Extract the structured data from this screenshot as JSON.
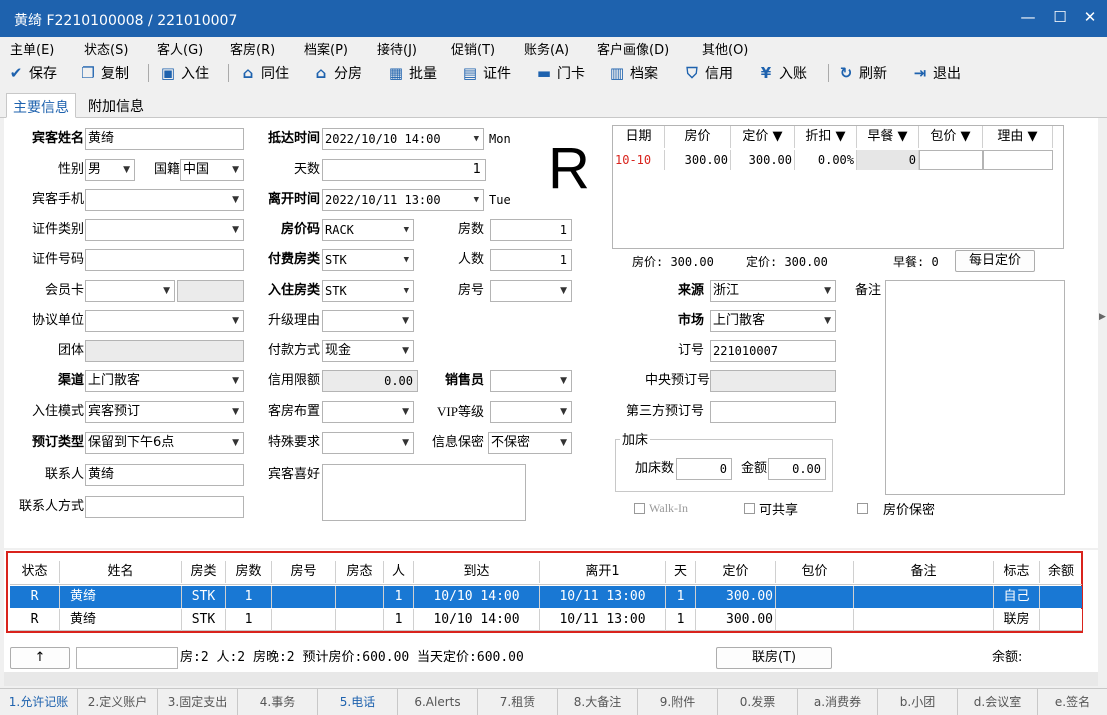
{
  "window": {
    "title": "黄绮 F2210100008 / 221010007",
    "min": "—",
    "max": "☐",
    "close": "✕"
  },
  "menu": [
    "主单(E)",
    "状态(S)",
    "客人(G)",
    "客房(R)",
    "档案(P)",
    "接待(J)",
    "促销(T)",
    "账务(A)",
    "客户画像(D)",
    "其他(O)"
  ],
  "toolbar": {
    "save": "保存",
    "copy": "复制",
    "checkin": "入住",
    "share": "同住",
    "assign": "分房",
    "batch": "批量",
    "cert": "证件",
    "card": "门卡",
    "profile": "档案",
    "credit": "信用",
    "post": "入账",
    "refresh": "刷新",
    "exit": "退出"
  },
  "tabs": {
    "main": "主要信息",
    "extra": "附加信息"
  },
  "form": {
    "guest_name_label": "宾客姓名",
    "guest_name": "黄绮",
    "gender_label": "性别",
    "gender": "男",
    "nationality_label": "国籍",
    "nationality": "中国",
    "mobile_label": "宾客手机",
    "mobile": "",
    "id_type_label": "证件类别",
    "id_type": "",
    "id_no_label": "证件号码",
    "id_no": "",
    "member_label": "会员卡",
    "member": "",
    "agreement_label": "协议单位",
    "agreement": "",
    "group_label": "团体",
    "group": "",
    "channel_label": "渠道",
    "channel": "上门散客",
    "checkin_mode_label": "入住模式",
    "checkin_mode": "宾客预订",
    "res_type_label": "预订类型",
    "res_type": "保留到下午6点",
    "contact_label": "联系人",
    "contact": "黄绮",
    "contact_method_label": "联系人方式",
    "contact_method": "",
    "arrival_label": "抵达时间",
    "arrival": "2022/10/10 14:00",
    "arrival_day": "Mon",
    "nights_label": "天数",
    "nights": "1",
    "depart_label": "离开时间",
    "depart": "2022/10/11 13:00",
    "depart_day": "Tue",
    "rate_code_label": "房价码",
    "rate_code": "RACK",
    "rooms_label": "房数",
    "rooms": "1",
    "pay_room_label": "付费房类",
    "pay_room": "STK",
    "persons_label": "人数",
    "persons": "1",
    "in_room_label": "入住房类",
    "in_room": "STK",
    "room_no_label": "房号",
    "room_no": "",
    "upgrade_label": "升级理由",
    "upgrade": "",
    "pay_method_label": "付款方式",
    "pay_method": "现金",
    "credit_label": "信用限额",
    "credit": "0.00",
    "sales_label": "销售员",
    "sales": "",
    "layout_label": "客房布置",
    "layout": "",
    "vip_label": "VIP等级",
    "vip": "",
    "special_label": "特殊要求",
    "special": "",
    "privacy_label": "信息保密",
    "privacy": "不保密",
    "pref_label": "宾客喜好",
    "pref": "",
    "status_big": "R",
    "source_label": "来源",
    "source": "浙江",
    "market_label": "市场",
    "market": "上门散客",
    "res_no_label": "订号",
    "res_no": "221010007",
    "central_label": "中央预订号",
    "central": "",
    "third_label": "第三方预订号",
    "third": "",
    "remark_label": "备注",
    "remark": "",
    "extra_bed_title": "加床",
    "extra_bed_label": "加床数",
    "extra_bed": "0",
    "amount_label": "金额",
    "amount": "0.00",
    "walkin_label": "Walk-In",
    "shareable_label": "可共享",
    "rate_secret_label": "房价保密"
  },
  "rate_grid": {
    "headers": [
      "日期",
      "房价",
      "定价 ▼",
      "折扣 ▼",
      "早餐 ▼",
      "包价 ▼",
      "理由 ▼"
    ],
    "rows": [
      [
        "10-10",
        "300.00",
        "300.00",
        "0.00%",
        "0",
        "",
        ""
      ]
    ],
    "summary_rate": "房价: 300.00",
    "summary_set": "定价: 300.00",
    "summary_bf": "早餐: 0",
    "daily_btn": "每日定价"
  },
  "room_list": {
    "headers": [
      "状态",
      "姓名",
      "房类",
      "房数",
      "房号",
      "房态",
      "人",
      "到达",
      "离开1",
      "天",
      "定价",
      "包价",
      "备注",
      "标志",
      "余额"
    ],
    "rows": [
      [
        "R",
        "黄绮",
        "STK",
        "1",
        "",
        "",
        "1",
        "10/10 14:00",
        "10/11 13:00",
        "1",
        "300.00",
        "",
        "",
        "自己",
        ""
      ],
      [
        "R",
        "黄绮",
        "STK",
        "1",
        "",
        "",
        "1",
        "10/10 14:00",
        "10/11 13:00",
        "1",
        "300.00",
        "",
        "",
        "联房",
        ""
      ]
    ]
  },
  "summary": {
    "up_btn": "↑",
    "text": "房:2  人:2  房晚:2  预计房价:600.00  当天定价:600.00",
    "link_btn": "联房(T)",
    "balance": "余额:"
  },
  "status_tabs": [
    "1.允许记账",
    "2.定义账户",
    "3.固定支出",
    "4.事务",
    "5.电话",
    "6.Alerts",
    "7.租赁",
    "8.大备注",
    "9.附件",
    "0.发票",
    "a.消费券",
    "b.小团",
    "d.会议室",
    "e.签名"
  ],
  "colors": {
    "title": "#1e62ae",
    "selection": "#1978d4",
    "highlight_box": "#d9231c",
    "date_red": "#d9231c"
  }
}
